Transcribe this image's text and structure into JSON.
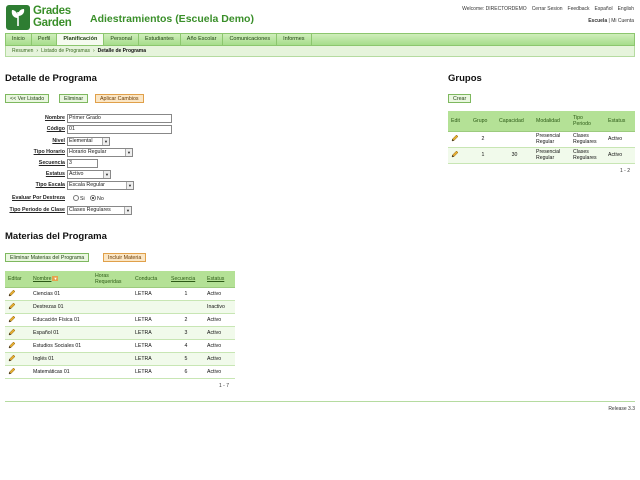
{
  "logo": {
    "line1": "Grades",
    "line2": "Garden"
  },
  "site_title": "Adiestramientos (Escuela Demo)",
  "top_links": [
    "Welcome: DIRECTORDEMO",
    "Cerrar Sesion",
    "Feedback",
    "Español",
    "English"
  ],
  "school_links": {
    "school": "Escuela",
    "separator": "|",
    "mine": "Mi Cuenta"
  },
  "nav": [
    "Inicio",
    "Perfil",
    "Planificación",
    "Personal",
    "Estudiantes",
    "Año Escolar",
    "Comunicaciones",
    "Informes"
  ],
  "nav_active": "Planificación",
  "breadcrumb": [
    "Resumen",
    "Listado de Programas",
    "Detalle de Programa"
  ],
  "detail": {
    "title": "Detalle de Programa",
    "buttons": {
      "back": "<< Ver Listado",
      "delete": "Eliminar",
      "apply": "Aplicar Cambios"
    },
    "fields": {
      "nombre": {
        "label": "Nombre",
        "value": "Primer Grado"
      },
      "codigo": {
        "label": "Código",
        "value": "01"
      },
      "nivel": {
        "label": "Nivel",
        "value": "Elemental"
      },
      "tipo_horario": {
        "label": "Tipo Horario",
        "value": "Horario Regular"
      },
      "secuencia": {
        "label": "Secuencia",
        "value": "3"
      },
      "estatus": {
        "label": "Estatus",
        "value": "Activo"
      },
      "tipo_escala": {
        "label": "Tipo Escala",
        "value": "Escala Regular"
      },
      "evaluar": {
        "label": "Evaluar Por Destreza",
        "opt_yes": "Si",
        "opt_no": "No",
        "selected": "No"
      },
      "tipo_periodo": {
        "label": "Tipo Periodo de Clase",
        "value": "Clases Regulares"
      }
    }
  },
  "grupos": {
    "title": "Grupos",
    "create": "Crear",
    "headers": [
      "Edit",
      "Grupo",
      "Capacidad",
      "Modalidad",
      "Tipo Periodo",
      "Estatus"
    ],
    "rows": [
      {
        "grupo": "2",
        "capacidad": "",
        "modalidad": "Presencial Regular",
        "periodo": "Clases Regulares",
        "estatus": "Activo"
      },
      {
        "grupo": "1",
        "capacidad": "30",
        "modalidad": "Presencial Regular",
        "periodo": "Clases Regulares",
        "estatus": "Activo"
      }
    ],
    "pager": "1 - 2"
  },
  "materias": {
    "title": "Materias del Programa",
    "buttons": {
      "remove": "Eliminar Materias del Programa",
      "include": "Incluir Materia"
    },
    "headers": [
      "Editar",
      "Nombre",
      "Horas Requeridas",
      "Conducta",
      "Secuencia",
      "Estatus"
    ],
    "rows": [
      {
        "nombre": "Ciencias 01",
        "horas": "",
        "conducta": "LETRA",
        "secuencia": "1",
        "estatus": "Activo"
      },
      {
        "nombre": "Destrezas 01",
        "horas": "",
        "conducta": "",
        "secuencia": "",
        "estatus": "Inactivo"
      },
      {
        "nombre": "Educación Física 01",
        "horas": "",
        "conducta": "LETRA",
        "secuencia": "2",
        "estatus": "Activo"
      },
      {
        "nombre": "Español 01",
        "horas": "",
        "conducta": "LETRA",
        "secuencia": "3",
        "estatus": "Activo"
      },
      {
        "nombre": "Estudios Sociales 01",
        "horas": "",
        "conducta": "LETRA",
        "secuencia": "4",
        "estatus": "Activo"
      },
      {
        "nombre": "Inglés 01",
        "horas": "",
        "conducta": "LETRA",
        "secuencia": "5",
        "estatus": "Activo"
      },
      {
        "nombre": "Matemáticas 01",
        "horas": "",
        "conducta": "LETRA",
        "secuencia": "6",
        "estatus": "Activo"
      }
    ],
    "pager": "1 - 7"
  },
  "release": "Release 3.3",
  "colors": {
    "brand_green": "#3a8f2a",
    "nav_bg": "#a6dd8b",
    "header_bg": "#b4e196",
    "orange_btn": "#fbe6c5"
  }
}
